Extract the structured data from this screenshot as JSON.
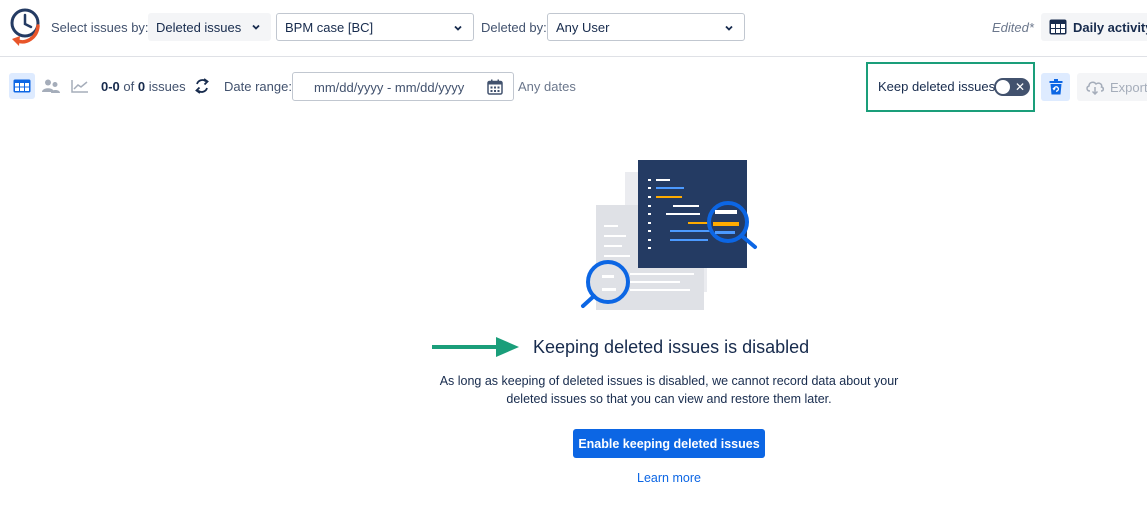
{
  "header": {
    "select_label": "Select issues by:",
    "select_value": "Deleted issues",
    "project_value": "BPM case [BC]",
    "deleted_by_label": "Deleted by:",
    "deleted_by_value": "Any User",
    "edited_text": "Edited*",
    "daily_activity_label": "Daily activity"
  },
  "toolbar": {
    "views": [
      "grid-icon",
      "users-icon",
      "trend-chart-icon"
    ],
    "count_range": "0-0",
    "count_of": "of",
    "count_total": "0",
    "count_unit": "issues",
    "date_range_label": "Date range:",
    "date_placeholder": "mm/dd/yyyy - mm/dd/yyyy",
    "any_dates": "Any dates",
    "keep_deleted_label": "Keep deleted issues",
    "keep_deleted_enabled": false,
    "toggle_off_glyph": "✕",
    "export_label": "Export"
  },
  "empty_state": {
    "title": "Keeping deleted issues is disabled",
    "description": "As long as keeping of deleted issues is disabled, we cannot record data about your deleted issues so that you can view and restore them later.",
    "enable_button": "Enable keeping deleted issues",
    "learn_more": "Learn more"
  },
  "colors": {
    "accent": "#0c66e4",
    "highlight_border": "#1a9e7a",
    "logo_orange": "#e8552a",
    "logo_navy": "#243b63"
  }
}
